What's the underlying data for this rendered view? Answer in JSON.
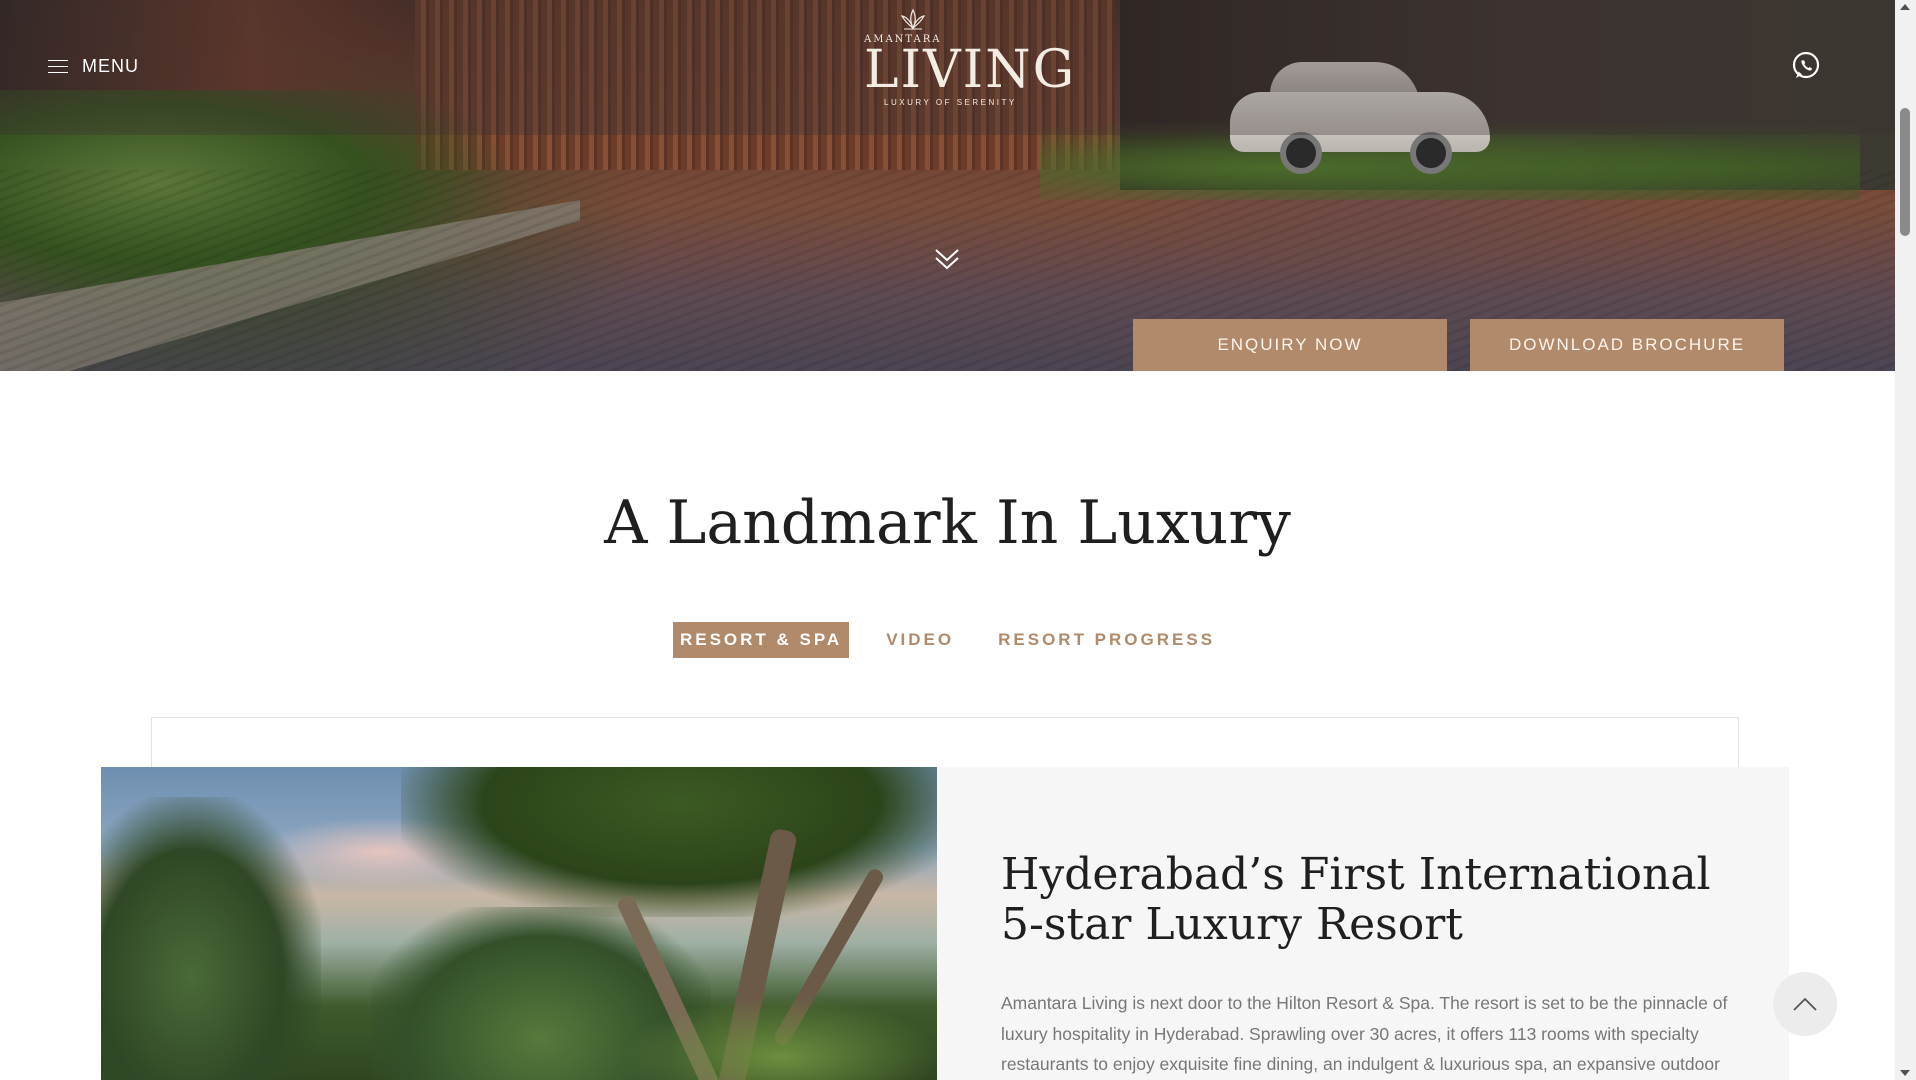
{
  "header": {
    "menu_label": "MENU",
    "menu_icon": "hamburger-icon",
    "whatsapp_icon": "whatsapp-icon"
  },
  "logo": {
    "brand_top": "AMANTARA",
    "brand_main": "LIVING",
    "tagline": "LUXURY OF SERENITY",
    "mark_icon": "lotus-icon"
  },
  "hero": {
    "scroll_icon": "double-chevron-down-icon",
    "enquiry_label": "ENQUIRY NOW",
    "brochure_label": "DOWNLOAD BROCHURE"
  },
  "section": {
    "title": "A Landmark In Luxury",
    "tabs": [
      {
        "label": "RESORT & SPA",
        "active": true
      },
      {
        "label": "VIDEO",
        "active": false
      },
      {
        "label": "RESORT PROGRESS",
        "active": false
      }
    ]
  },
  "feature": {
    "title": "Hyderabad’s First International 5-star Luxury Resort",
    "text": "Amantara Living is next door to the Hilton Resort & Spa. The resort is set to be the pinnacle of luxury hospitality in Hyderabad. Sprawling over 30 acres, it offers 113 rooms with specialty restaurants to enjoy exquisite fine dining, an indulgent & luxurious spa, an expansive outdoor"
  },
  "back_to_top_icon": "chevron-up-icon",
  "colors": {
    "accent": "#b08a6a",
    "title_text": "#1f1f1f",
    "body_text": "#777777",
    "panel_bg": "#f6f6f6"
  }
}
